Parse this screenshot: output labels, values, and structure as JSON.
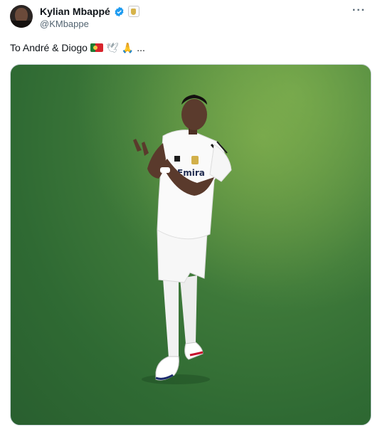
{
  "author": {
    "name": "Kylian Mbappé",
    "handle": "@KMbappe",
    "verified_icon": "verified-badge-icon",
    "affiliation_icon": "real-madrid-badge-icon"
  },
  "menu": {
    "more_label": "···"
  },
  "tweet": {
    "text": "To André & Diogo",
    "emojis": [
      "portugal-flag",
      "dove",
      "folded-hands"
    ],
    "trail": "..."
  },
  "colors": {
    "accent": "#1d9bf0",
    "text": "#0f1419",
    "secondary_text": "#536471",
    "pitch": "#3f7a3a"
  }
}
